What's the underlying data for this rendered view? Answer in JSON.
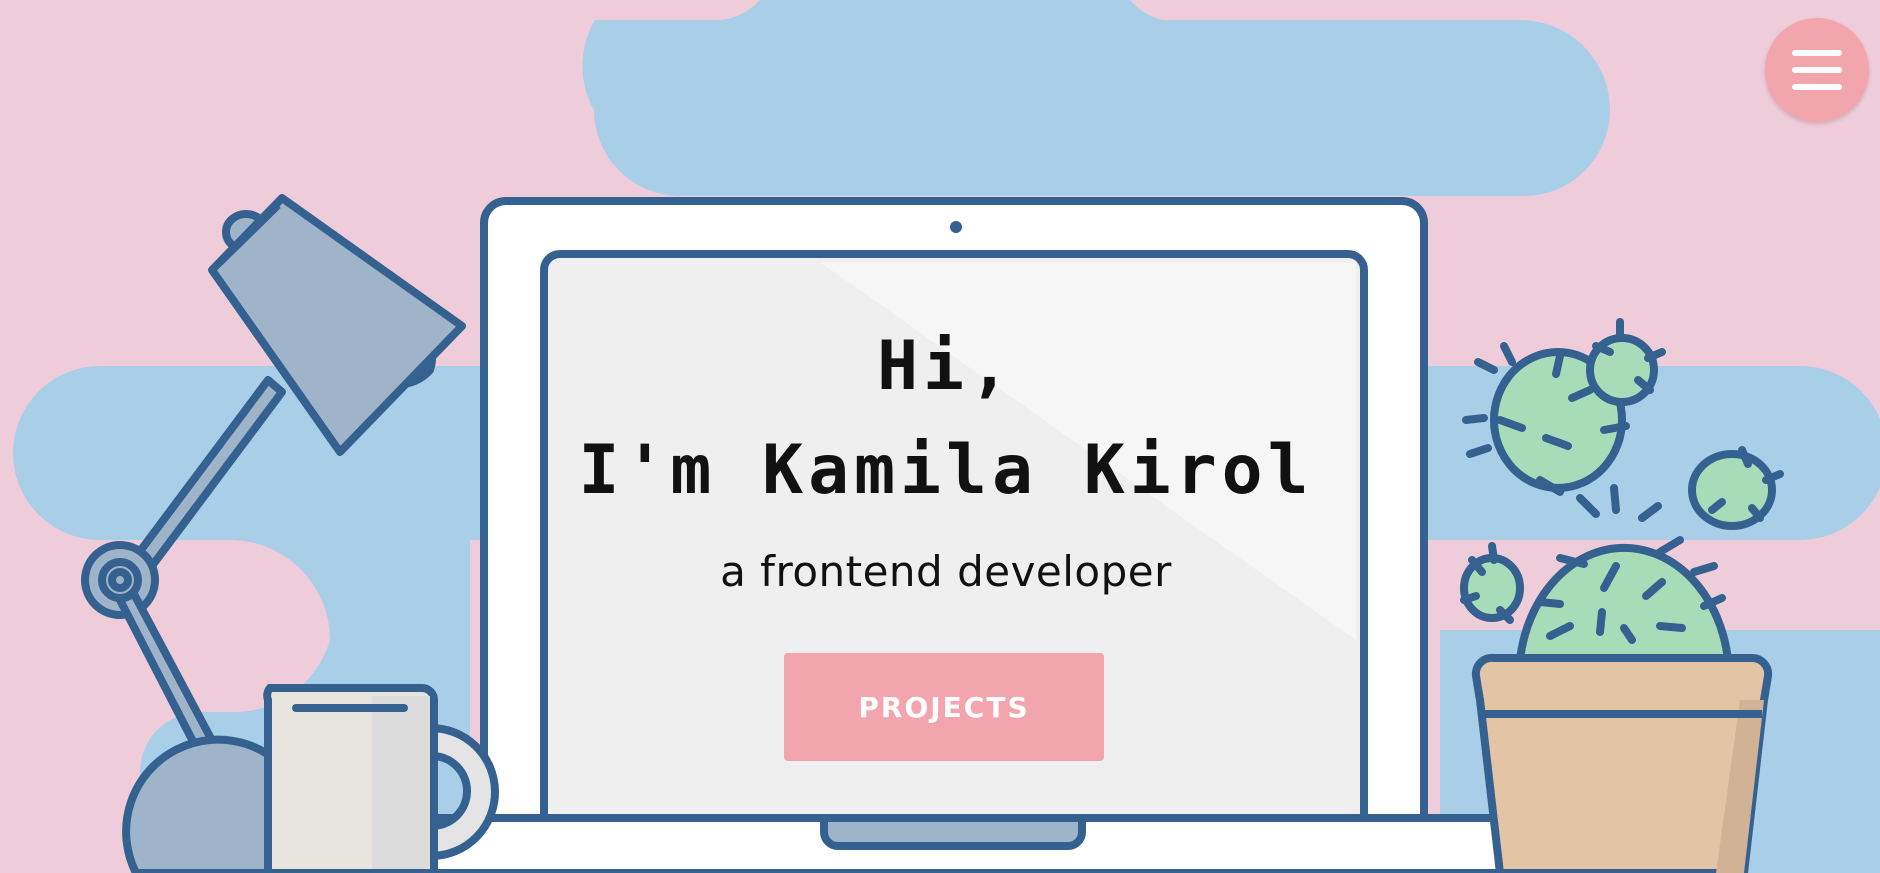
{
  "hero": {
    "greeting_line1": "Hi,",
    "greeting_line2": "I'm Kamila Kirol",
    "subtitle": "a frontend developer",
    "cta_label": "PROJECTS"
  },
  "nav": {
    "menu_icon": "hamburger-icon"
  },
  "colors": {
    "background": "#efccd9",
    "cloud": "#a8cee8",
    "outline": "#34618f",
    "accent": "#f3a5ad",
    "cactus": "#a8dcb8",
    "pot": "#e3c5a5",
    "mug": "#e8e5df",
    "lamp": "#9fb4c9"
  }
}
